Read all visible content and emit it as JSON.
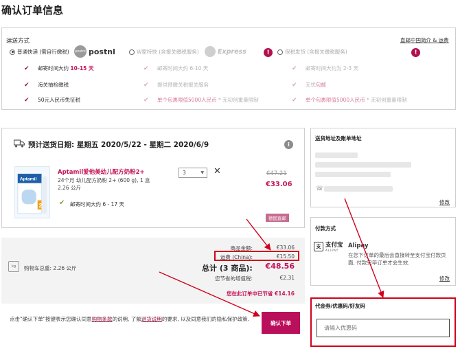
{
  "page_title": "确认订单信息",
  "shipping": {
    "label": "运送方式",
    "info_link": "直邮中国简介 & 运费",
    "options": [
      {
        "label": "普通快递 (需自行缴税)",
        "selected": true,
        "logo": "postnl",
        "logo_badge": "postnl"
      },
      {
        "label": "W家特快 (含报关缴税服务)",
        "selected": false,
        "logo": "Express"
      },
      {
        "label": "保税发货 (含报关缴税服务)",
        "selected": false
      }
    ],
    "features": [
      [
        "邮寄时间大约",
        "10-15 天",
        "邮寄时间大约 6-10 天",
        "邮寄时间大约为 2-3 天"
      ],
      [
        "海关抽检缴税",
        "提供预缴关税报关服务",
        "无忧",
        "包邮"
      ],
      [
        "50元人民币免征税",
        "单个包裹限值5000人民币",
        "* 无初创重量限制",
        "单个包裹限值5000人民币",
        "* 无初创重量限制"
      ]
    ]
  },
  "delivery": {
    "title": "预计送货日期: 星期五 2020/5/22 - 星期二 2020/6/9",
    "product": {
      "name": "Aptamil爱他美幼儿配方奶粉2+",
      "sub_line1": "24个月 幼儿配方奶粉 2+ (600 g), 1 盒",
      "sub_line2": "2.26 公斤",
      "ship_time": "邮寄时间大约 6 - 17 天",
      "qty": "3",
      "price_old": "€47.21",
      "price_new": "€33.06",
      "tag": "德国直邮",
      "image_text": "Aptamil"
    }
  },
  "summary": {
    "cart_weight": "购物车总重:  2.26 公斤",
    "cart_icon": "kg",
    "goods_label": "商品金额:",
    "goods_value": "€33.06",
    "shipping_label": "运费 (China):",
    "shipping_value": "€15.50",
    "total_label": "总计 (3 商品):",
    "total_value": "€48.56",
    "vat_label": "您节省的增值税:",
    "vat_value": "€2.31",
    "savings": "您在此订单中已节省 €14.16"
  },
  "terms": {
    "part1": "点击\"确认下单\"按键表示您确认同意",
    "link1": "购物条款",
    "part2": "的说明, 了解",
    "link2": "退货说明",
    "part3": "的要求, 以及同意我们的隐私保护政策."
  },
  "confirm_button": "确认下单",
  "address": {
    "title": "送货地址及账单地址",
    "edit": "修改"
  },
  "payment": {
    "title": "付款方式",
    "logo_text": "支付宝",
    "logo_sub": "ALIPAY",
    "logo_glyph": "支",
    "name": "Alipay",
    "desc": "在您下订单的最后会直接转至支付宝付款页面, 付款完毕订单才会生效.",
    "edit": "修改"
  },
  "coupon": {
    "title": "代金券/优惠码/好友码",
    "placeholder": "请输入优惠码"
  },
  "colors": {
    "accent": "#c4155a",
    "brand": "#ba0f5b",
    "annotation": "#d0021b"
  }
}
